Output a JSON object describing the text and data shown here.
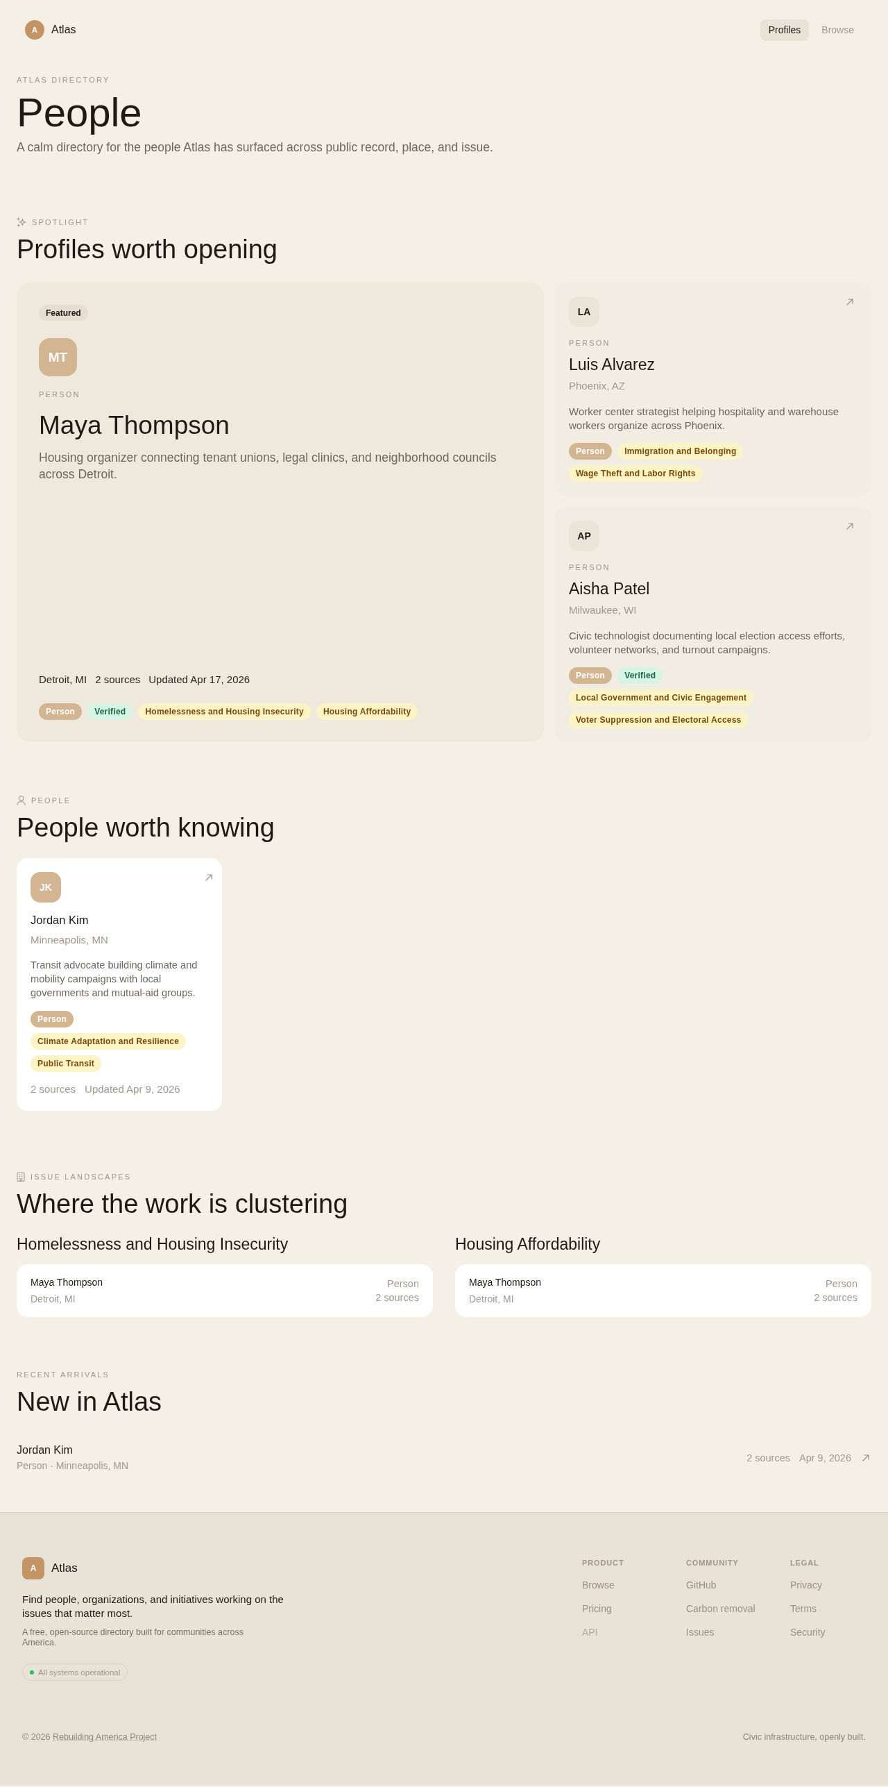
{
  "header": {
    "logo": {
      "initial": "A",
      "name": "Atlas"
    },
    "nav": [
      {
        "label": "Profiles",
        "selected": true
      },
      {
        "label": "Browse",
        "selected": false
      }
    ]
  },
  "hero": {
    "eyebrow": "ATLAS DIRECTORY",
    "title": "People",
    "subtitle": "A calm directory for the people Atlas has surfaced across public record, place, and issue."
  },
  "spotlight": {
    "eyebrow": "SPOTLIGHT",
    "title": "Profiles worth opening",
    "featured": {
      "badge": "Featured",
      "avatar": {
        "initials": "MT",
        "kind": "filled"
      },
      "type": "PERSON",
      "name": "Maya Thompson",
      "description": "Housing organizer connecting tenant unions, legal clinics, and neighborhood councils across Detroit.",
      "location": "Detroit, MI",
      "sources": "2 sources",
      "updated": "Updated Apr 17, 2026",
      "tags": [
        {
          "label": "Person",
          "kind": "type"
        },
        {
          "label": "Verified",
          "kind": "verified"
        },
        {
          "label": "Homelessness and Housing Insecurity",
          "kind": "issue"
        },
        {
          "label": "Housing Affordability",
          "kind": "issue"
        }
      ]
    },
    "profiles": [
      {
        "avatar": {
          "initials": "LA",
          "kind": "plain"
        },
        "type": "PERSON",
        "name": "Luis Alvarez",
        "location": "Phoenix, AZ",
        "description": "Worker center strategist helping hospitality and warehouse workers organize across Phoenix.",
        "tags": [
          {
            "label": "Person",
            "kind": "type"
          },
          {
            "label": "Immigration and Belonging",
            "kind": "issue"
          },
          {
            "label": "Wage Theft and Labor Rights",
            "kind": "issue"
          }
        ]
      },
      {
        "avatar": {
          "initials": "AP",
          "kind": "plain"
        },
        "type": "PERSON",
        "name": "Aisha Patel",
        "location": "Milwaukee, WI",
        "description": "Civic technologist documenting local election access efforts, volunteer networks, and turnout campaigns.",
        "tags": [
          {
            "label": "Person",
            "kind": "type"
          },
          {
            "label": "Verified",
            "kind": "verified"
          },
          {
            "label": "Local Government and Civic Engagement",
            "kind": "issue"
          },
          {
            "label": "Voter Suppression and Electoral Access",
            "kind": "issue"
          }
        ]
      }
    ]
  },
  "people": {
    "eyebrow": "PEOPLE",
    "title": "People worth knowing",
    "cards": [
      {
        "avatar": {
          "initials": "JK",
          "kind": "filled"
        },
        "name": "Jordan Kim",
        "location": "Minneapolis, MN",
        "description": "Transit advocate building climate and mobility campaigns with local governments and mutual-aid groups.",
        "tags": [
          {
            "label": "Person",
            "kind": "type"
          },
          {
            "label": "Climate Adaptation and Resilience",
            "kind": "issue"
          },
          {
            "label": "Public Transit",
            "kind": "issue"
          }
        ],
        "sources": "2 sources",
        "updated": "Updated Apr 9, 2026"
      }
    ]
  },
  "issues": {
    "eyebrow": "ISSUE LANDSCAPES",
    "title": "Where the work is clustering",
    "groups": [
      {
        "title": "Homelessness and Housing Insecurity",
        "entries": [
          {
            "name": "Maya Thompson",
            "location": "Detroit, MI",
            "type": "Person",
            "sources": "2 sources"
          }
        ]
      },
      {
        "title": "Housing Affordability",
        "entries": [
          {
            "name": "Maya Thompson",
            "location": "Detroit, MI",
            "type": "Person",
            "sources": "2 sources"
          }
        ]
      }
    ]
  },
  "recent": {
    "eyebrow": "RECENT ARRIVALS",
    "title": "New in Atlas",
    "items": [
      {
        "name": "Jordan Kim",
        "meta": "Person · Minneapolis, MN",
        "sources": "2 sources",
        "date": "Apr 9, 2026"
      }
    ]
  },
  "footer": {
    "logo": {
      "initial": "A",
      "name": "Atlas"
    },
    "tagline": "Find people, organizations, and initiatives working on the issues that matter most.",
    "note": "A free, open-source directory built for communities across America.",
    "status": "All systems operational",
    "columns": [
      {
        "title": "PRODUCT",
        "links": [
          {
            "label": "Browse",
            "disabled": false
          },
          {
            "label": "Pricing",
            "disabled": false
          },
          {
            "label": "API",
            "disabled": true
          }
        ]
      },
      {
        "title": "COMMUNITY",
        "links": [
          {
            "label": "GitHub",
            "disabled": false
          },
          {
            "label": "Carbon removal",
            "disabled": false
          },
          {
            "label": "Issues",
            "disabled": false
          }
        ]
      },
      {
        "title": "LEGAL",
        "links": [
          {
            "label": "Privacy",
            "disabled": false
          },
          {
            "label": "Terms",
            "disabled": false
          },
          {
            "label": "Security",
            "disabled": false
          }
        ]
      }
    ],
    "copyright": {
      "prefix": "© 2026",
      "link": "Rebuilding America Project"
    },
    "motto": "Civic infrastructure, openly built."
  }
}
